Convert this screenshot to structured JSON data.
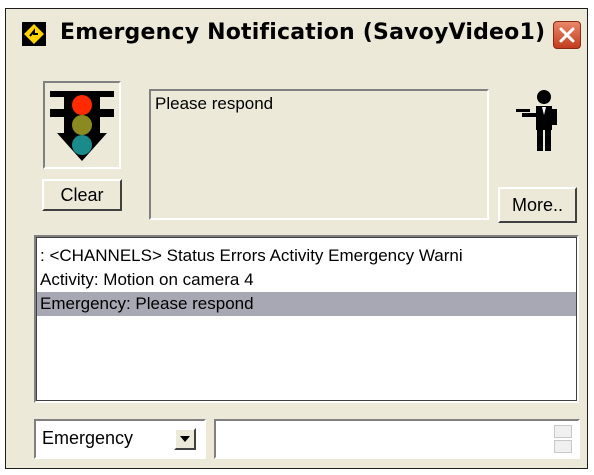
{
  "window": {
    "title": "Emergency Notification (SavoyVideo1)"
  },
  "controls": {
    "clear_label": "Clear",
    "more_label": "More..",
    "message": "Please respond"
  },
  "list": {
    "items": [
      ": <CHANNELS> Status Errors Activity Emergency Warni",
      "Activity: Motion on camera 4",
      "Emergency: Please respond"
    ],
    "selected_index": 2
  },
  "footer": {
    "channel_value": "Emergency",
    "input_value": ""
  },
  "icons": {
    "app": "app-diamond-icon",
    "close": "close-icon",
    "signal": "traffic-light-icon",
    "butler": "butler-icon",
    "dropdown": "chevron-down-icon"
  },
  "colors": {
    "window_bg": "#ece9d8",
    "selection": "#a8a8b4",
    "close_red": "#d4502f",
    "light_red": "#ff2a00",
    "light_yellow": "#8a8a20",
    "light_teal": "#1a8a8a"
  }
}
